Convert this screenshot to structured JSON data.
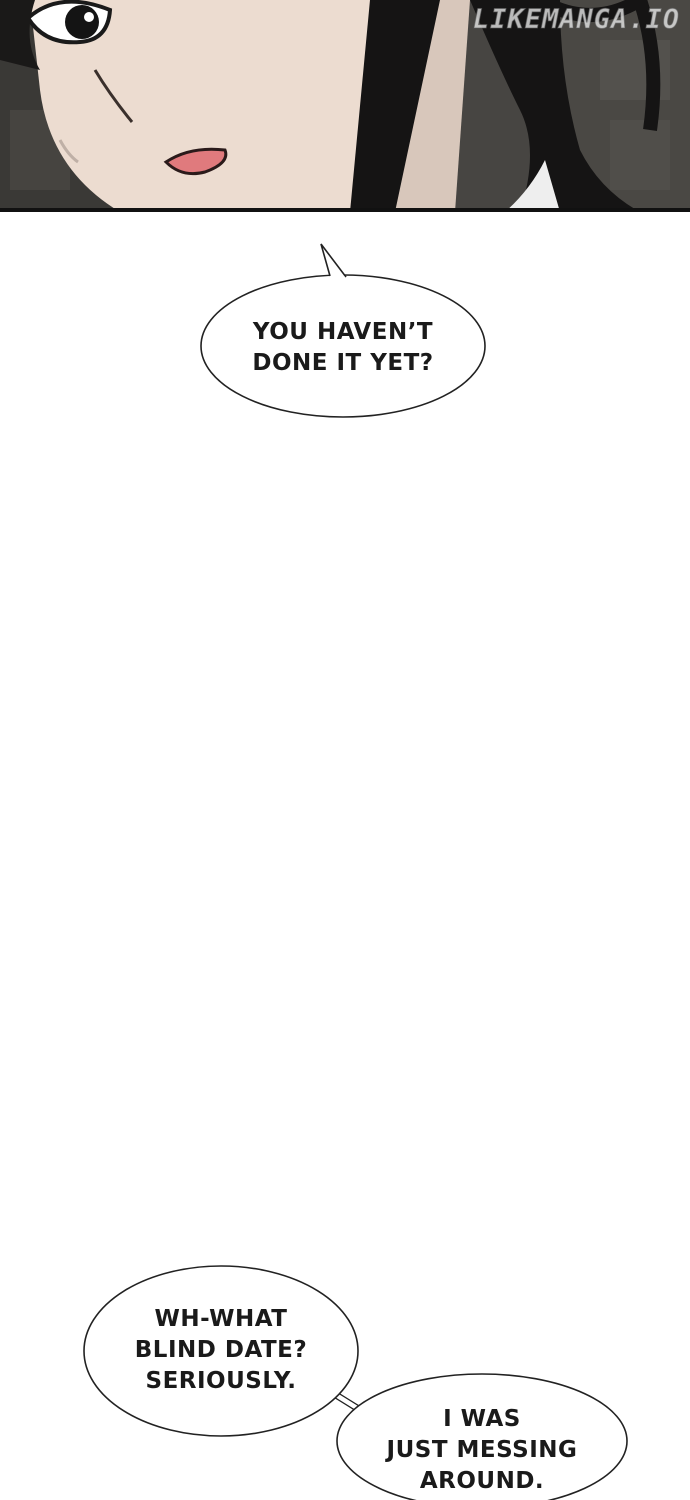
{
  "watermark": "LIKEMANGA.IO",
  "colors": {
    "background": "#ffffff",
    "skin": "#e8d9cc",
    "hair": "#151414",
    "lips": "#e07a7d",
    "bubble_stroke": "#222222"
  },
  "bubbles": [
    {
      "text": "YOU HAVEN’T\nDONE IT YET?"
    },
    {
      "text": "WH-WHAT\nBLIND DATE?\nSERIOUSLY."
    },
    {
      "text": "I WAS\nJUST MESSING\nAROUND."
    }
  ]
}
